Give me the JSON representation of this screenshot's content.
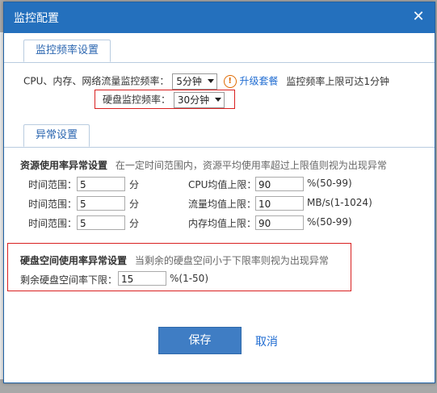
{
  "dialog": {
    "title": "监控配置",
    "close_glyph": "✕"
  },
  "monitor_freq": {
    "tab_label": "监控频率设置",
    "cpu_label": "CPU、内存、网络流量监控频率：",
    "cpu_value": "5分钟",
    "upgrade_link": "升级套餐",
    "upgrade_note": "监控频率上限可达1分钟",
    "disk_label": "硬盘监控频率：",
    "disk_value": "30分钟"
  },
  "anomaly": {
    "tab_label": "异常设置",
    "resource_title": "资源使用率异常设置",
    "resource_hint": "在一定时间范围内，资源平均使用率超过上限值则视为出现异常",
    "rows": [
      {
        "time_label": "时间范围：",
        "time_value": "5",
        "time_unit": "分",
        "metric_label": "CPU均值上限：",
        "metric_value": "90",
        "metric_unit": "%(50-99)"
      },
      {
        "time_label": "时间范围：",
        "time_value": "5",
        "time_unit": "分",
        "metric_label": "流量均值上限：",
        "metric_value": "10",
        "metric_unit": "MB/s(1-1024)"
      },
      {
        "time_label": "时间范围：",
        "time_value": "5",
        "time_unit": "分",
        "metric_label": "内存均值上限：",
        "metric_value": "90",
        "metric_unit": "%(50-99)"
      }
    ],
    "disk_title": "硬盘空间使用率异常设置",
    "disk_hint": "当剩余的硬盘空间小于下限率则视为出现异常",
    "disk_label": "剩余硬盘空间率下限：",
    "disk_value": "15",
    "disk_unit": "%(1-50)"
  },
  "footer": {
    "save_label": "保存",
    "cancel_label": "取消"
  },
  "colors": {
    "titlebar": "#2470bd",
    "accent_link": "#1e6bd1",
    "highlight_box": "#d92020",
    "save_button": "#3f7dc4"
  }
}
